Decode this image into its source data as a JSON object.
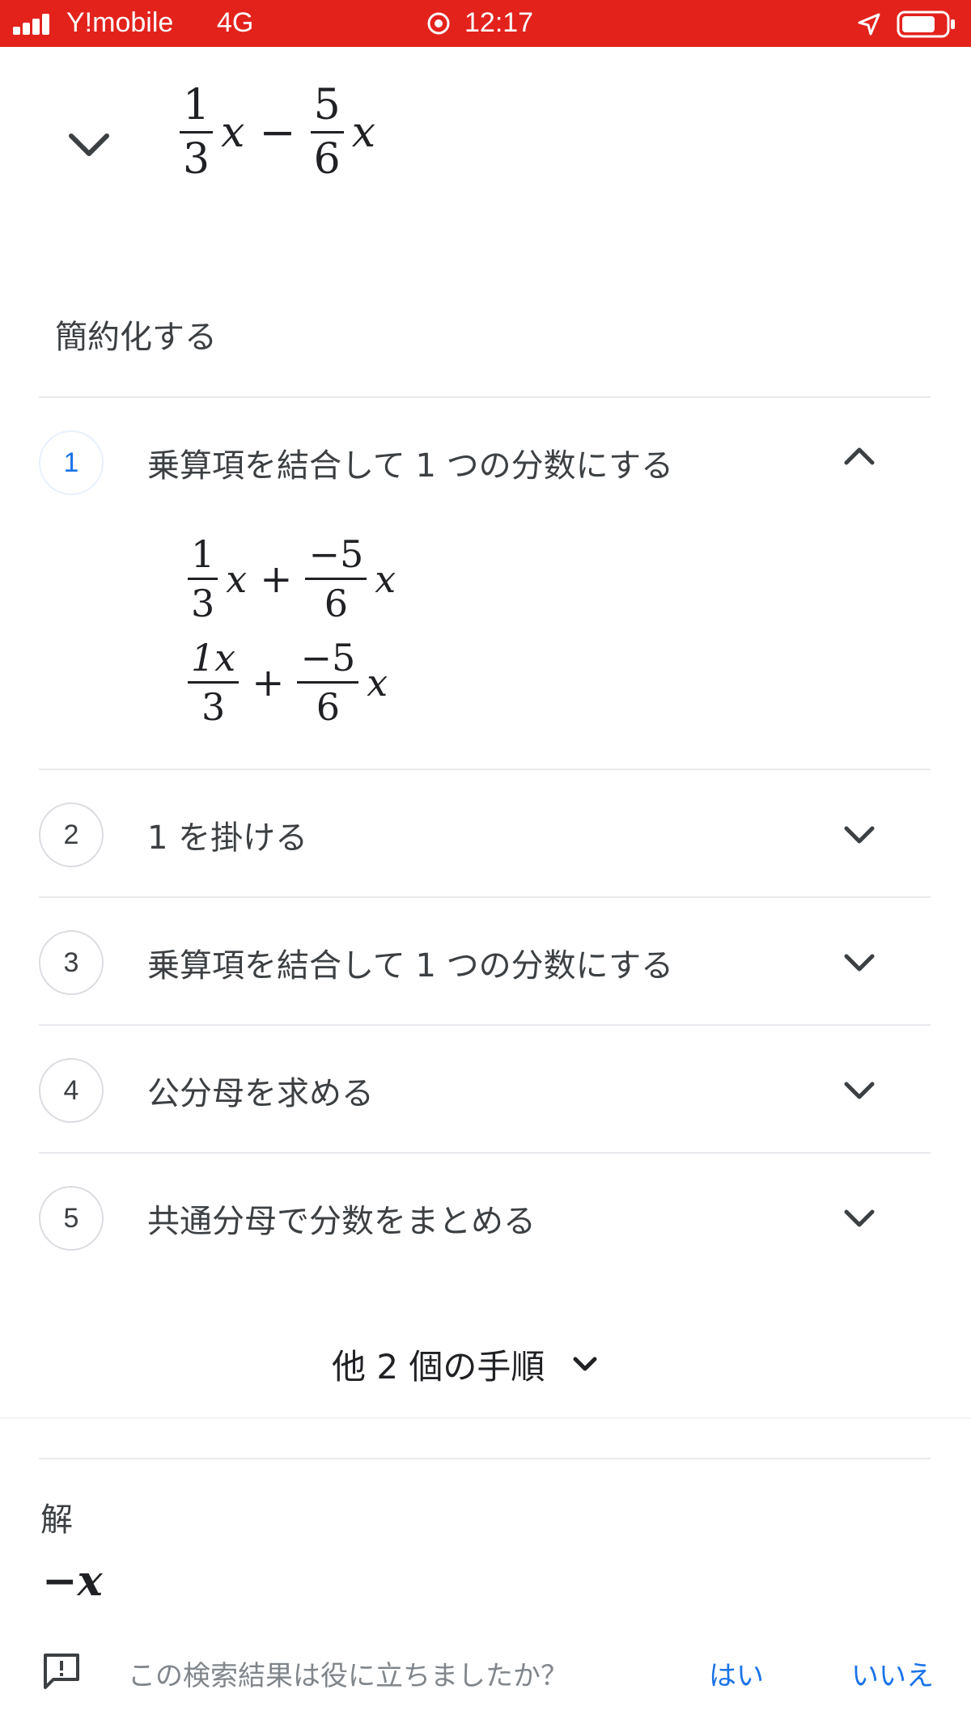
{
  "status_bar": {
    "carrier": "Y!mobile",
    "network": "4G",
    "time": "12:17",
    "icons": [
      "signal-icon",
      "orientation-lock-icon",
      "location-icon",
      "battery-icon"
    ],
    "background": "#e3221c"
  },
  "header": {
    "expression": {
      "a_num": "1",
      "a_den": "3",
      "var": "x",
      "op": "−",
      "b_num": "5",
      "b_den": "6"
    }
  },
  "section_title": "簡約化する",
  "steps": [
    {
      "number": "1",
      "label": "乗算項を結合して 1 つの分数にする",
      "expanded": true,
      "work": [
        {
          "a_num": "1",
          "a_den": "3",
          "a_tail": "x",
          "op": "+",
          "b_num": "−5",
          "b_den": "6",
          "b_tail": "x"
        },
        {
          "a_num": "1x",
          "a_den": "3",
          "a_tail": "",
          "op": "+",
          "b_num": "−5",
          "b_den": "6",
          "b_tail": "x"
        }
      ]
    },
    {
      "number": "2",
      "label": "1 を掛ける",
      "expanded": false
    },
    {
      "number": "3",
      "label": "乗算項を結合して 1 つの分数にする",
      "expanded": false
    },
    {
      "number": "4",
      "label": "公分母を求める",
      "expanded": false
    },
    {
      "number": "5",
      "label": "共通分母で分数をまとめる",
      "expanded": false
    }
  ],
  "more_steps_label": "他 2 個の手順",
  "solution": {
    "label": "解",
    "value": "−x"
  },
  "feedback": {
    "question": "この検索結果は役に立ちましたか？",
    "yes": "はい",
    "no": "いいえ"
  },
  "colors": {
    "accent": "#1a73e8",
    "text": "#3c4043",
    "divider": "#e8eaed"
  }
}
